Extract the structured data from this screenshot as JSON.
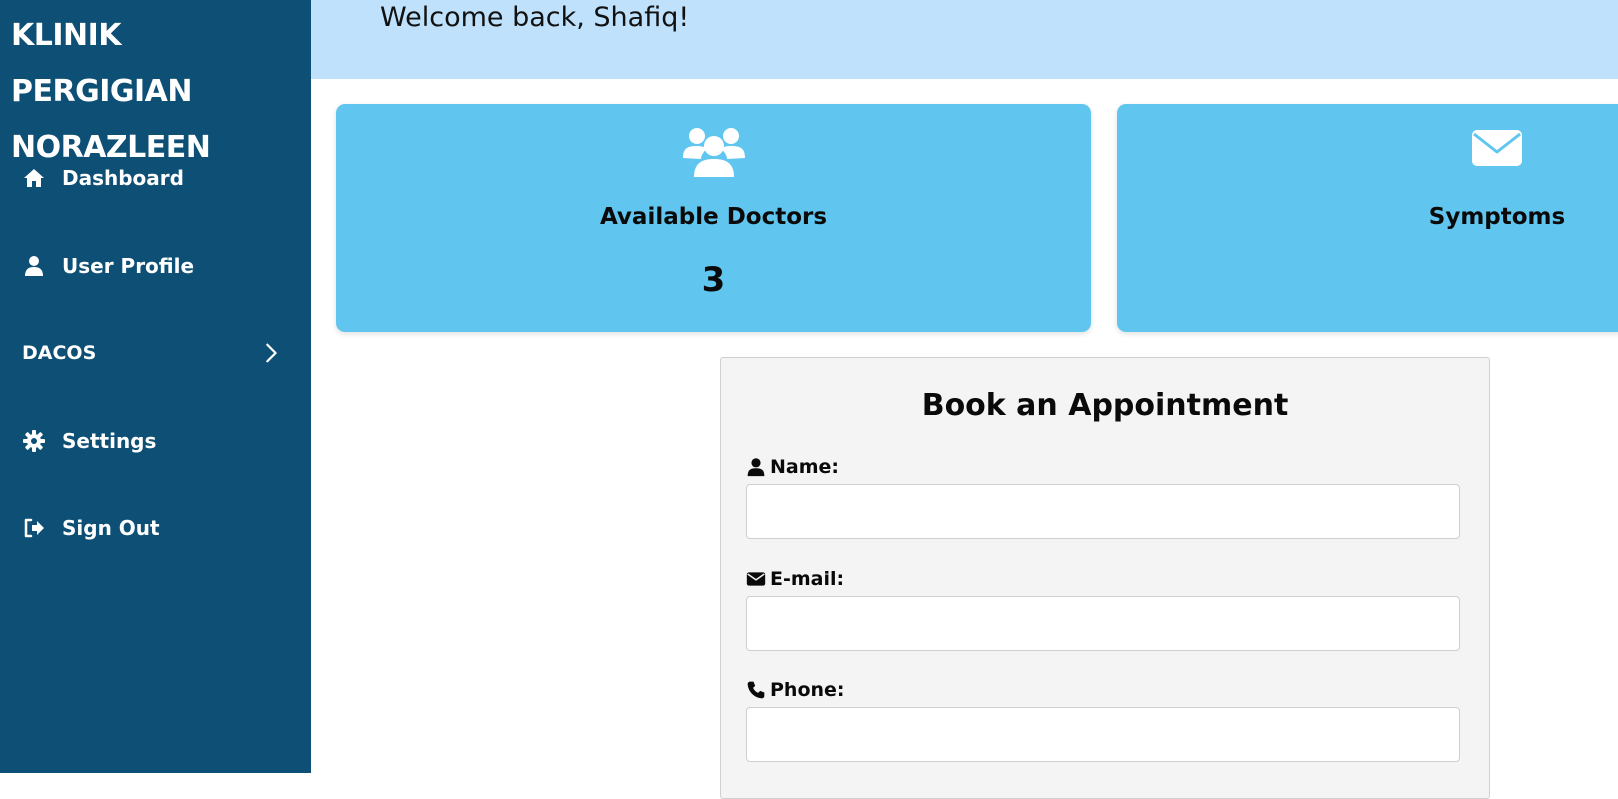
{
  "sidebar": {
    "brand_line1": "KLINIK PERGIGIAN",
    "brand_line2": "NORAZLEEN",
    "items": [
      {
        "label": "Dashboard",
        "icon": "home-icon"
      },
      {
        "label": "User Profile",
        "icon": "user-icon"
      },
      {
        "label": "DACOS",
        "icon": "chevron-right-icon"
      },
      {
        "label": "Settings",
        "icon": "gear-icon"
      },
      {
        "label": "Sign Out",
        "icon": "sign-out-icon"
      }
    ]
  },
  "header": {
    "welcome": "Welcome back, Shafiq!"
  },
  "cards": [
    {
      "title": "Available Doctors",
      "count": "3",
      "icon": "users-icon"
    },
    {
      "title": "Symptoms",
      "icon": "envelope-icon"
    }
  ],
  "form": {
    "title": "Book an Appointment",
    "fields": [
      {
        "label": "Name:",
        "icon": "user-icon",
        "value": "",
        "placeholder": ""
      },
      {
        "label": "E-mail:",
        "icon": "envelope-icon",
        "value": "",
        "placeholder": ""
      },
      {
        "label": "Phone:",
        "icon": "phone-icon",
        "value": "",
        "placeholder": ""
      }
    ]
  },
  "colors": {
    "sidebar_bg": "#0d4f75",
    "topbar_bg": "#bfe1fb",
    "card_bg": "#60c6ef",
    "form_bg": "#f4f4f4"
  }
}
